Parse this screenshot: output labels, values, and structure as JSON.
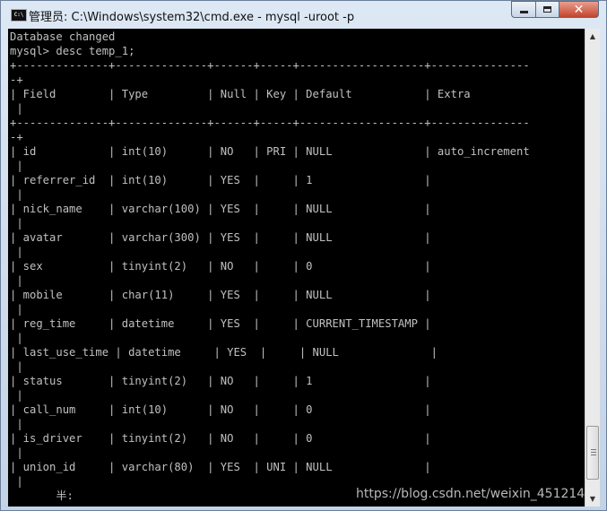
{
  "window": {
    "title": "管理员: C:\\Windows\\system32\\cmd.exe - mysql  -uroot -p",
    "icon_text": "C:\\",
    "close_label": "✕"
  },
  "console": {
    "lines": [
      "Database changed",
      "mysql> desc temp_1;",
      "+--------------+--------------+------+-----+-------------------+---------------",
      "-+",
      "| Field        | Type         | Null | Key | Default           | Extra",
      " |",
      "+--------------+--------------+------+-----+-------------------+---------------",
      "-+",
      "| id           | int(10)      | NO   | PRI | NULL              | auto_increment",
      " |",
      "| referrer_id  | int(10)      | YES  |     | 1                 |",
      " |",
      "| nick_name    | varchar(100) | YES  |     | NULL              |",
      " |",
      "| avatar       | varchar(300) | YES  |     | NULL              |",
      " |",
      "| sex          | tinyint(2)   | NO   |     | 0                 |",
      " |",
      "| mobile       | char(11)     | YES  |     | NULL              |",
      " |",
      "| reg_time     | datetime     | YES  |     | CURRENT_TIMESTAMP |",
      " |",
      "| last_use_time | datetime     | YES  |     | NULL              |",
      " |",
      "| status       | tinyint(2)   | NO   |     | 1                 |",
      " |",
      "| call_num     | int(10)      | NO   |     | 0                 |",
      " |",
      "| is_driver    | tinyint(2)   | NO   |     | 0                 |",
      " |",
      "| union_id     | varchar(80)  | YES  | UNI | NULL              |",
      " |",
      "       半:"
    ]
  },
  "watermark": "https://blog.csdn.net/weixin_451214"
}
